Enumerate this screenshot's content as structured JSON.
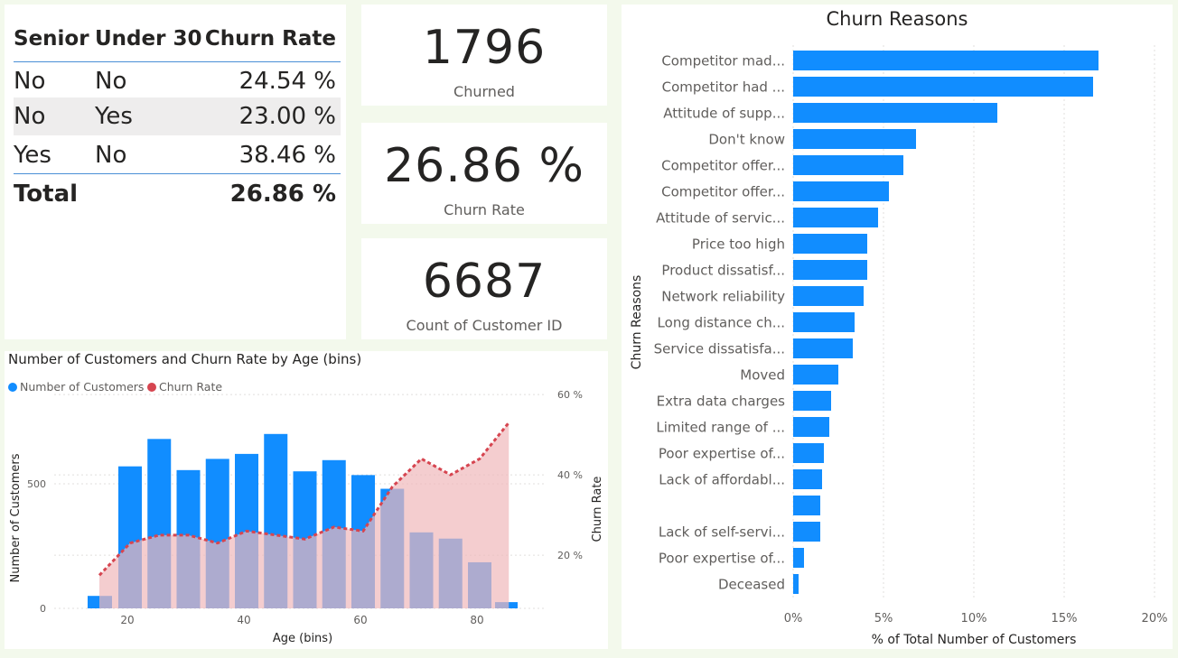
{
  "matrix": {
    "headers": [
      "Senior",
      "Under 30",
      "Churn Rate"
    ],
    "rows": [
      {
        "senior": "No",
        "under30": "No",
        "rate": "24.54 %"
      },
      {
        "senior": "No",
        "under30": "Yes",
        "rate": "23.00 %"
      },
      {
        "senior": "Yes",
        "under30": "No",
        "rate": "38.46 %"
      }
    ],
    "total": {
      "label": "Total",
      "rate": "26.86 %"
    }
  },
  "kpis": [
    {
      "value": "1796",
      "label": "Churned"
    },
    {
      "value": "26.86 %",
      "label": "Churn Rate"
    },
    {
      "value": "6687",
      "label": "Count of Customer ID"
    }
  ],
  "colors": {
    "blue": "#118dff",
    "red": "#d64550",
    "red_fill": "#efb8bb",
    "overlap": "#6470b8"
  },
  "chart_data": [
    {
      "type": "bar",
      "title": "Number of Customers and Churn Rate by Age (bins)",
      "xlabel": "Age (bins)",
      "ylabel": "Number of Customers",
      "y2label": "Churn Rate",
      "legend": [
        "Number of Customers",
        "Churn Rate"
      ],
      "x_ticks": [
        "20",
        "40",
        "60",
        "80"
      ],
      "y_ticks": [
        "0",
        "500"
      ],
      "y2_ticks": [
        "20 %",
        "40 %",
        "60 %"
      ],
      "x": [
        15,
        20,
        25,
        30,
        35,
        40,
        45,
        50,
        55,
        60,
        65,
        70,
        75,
        80,
        85
      ],
      "series": [
        {
          "name": "Number of Customers",
          "type": "bar",
          "values": [
            50,
            570,
            680,
            555,
            600,
            620,
            700,
            550,
            595,
            535,
            480,
            305,
            280,
            185,
            25
          ]
        },
        {
          "name": "Churn Rate",
          "type": "area",
          "values": [
            15,
            23,
            25,
            25,
            23,
            26,
            25,
            24,
            27,
            26,
            37,
            44,
            40,
            44,
            53
          ]
        }
      ],
      "ylim": [
        0,
        1000
      ],
      "y2lim": [
        0,
        65
      ]
    },
    {
      "type": "bar",
      "orientation": "horizontal",
      "title": "Churn Reasons",
      "xlabel": "% of Total Number of Customers",
      "ylabel": "Churn Reasons",
      "x_ticks": [
        "0%",
        "5%",
        "10%",
        "15%",
        "20%"
      ],
      "xlim": [
        0,
        20
      ],
      "categories": [
        "Competitor mad...",
        "Competitor had ...",
        "Attitude of supp...",
        "Don't know",
        "Competitor offer...",
        "Competitor offer...",
        "Attitude of servic...",
        "Price too high",
        "Product dissatisf...",
        "Network reliability",
        "Long distance ch...",
        "Service dissatisfa...",
        "Moved",
        "Extra data charges",
        "Limited range of ...",
        "Poor expertise of...",
        "Lack of affordabl...",
        "",
        "Lack of self-servi...",
        "Poor expertise of...",
        "Deceased"
      ],
      "values": [
        16.9,
        16.6,
        11.3,
        6.8,
        6.1,
        5.3,
        4.7,
        4.1,
        4.1,
        3.9,
        3.4,
        3.3,
        2.5,
        2.1,
        2.0,
        1.7,
        1.6,
        1.5,
        1.5,
        0.6,
        0.3
      ]
    }
  ]
}
